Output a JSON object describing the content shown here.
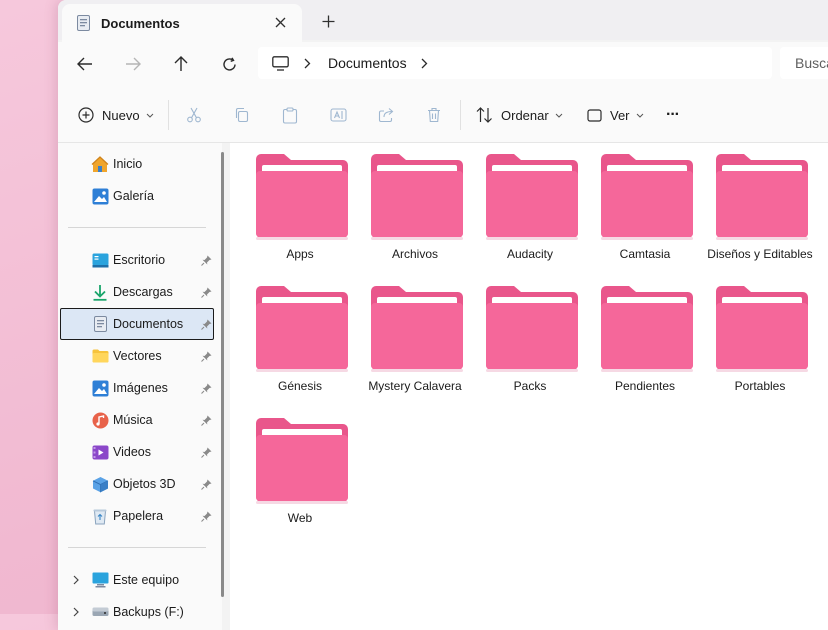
{
  "window": {
    "tab_title": "Documentos",
    "new_tab_symbol": "+"
  },
  "address": {
    "crumb": "Documentos",
    "search_placeholder": "Buscar en Documentos"
  },
  "commands": {
    "new_label": "Nuevo",
    "sort_label": "Ordenar",
    "view_label": "Ver",
    "more_label": "···"
  },
  "sidebar": {
    "top": [
      {
        "label": "Inicio",
        "icon": "home-icon"
      },
      {
        "label": "Galería",
        "icon": "gallery-icon"
      }
    ],
    "pinned": [
      {
        "label": "Escritorio",
        "icon": "desktop-icon"
      },
      {
        "label": "Descargas",
        "icon": "download-icon"
      },
      {
        "label": "Documentos",
        "icon": "document-icon",
        "selected": true
      },
      {
        "label": "Vectores",
        "icon": "folder-icon"
      },
      {
        "label": "Imágenes",
        "icon": "image-icon"
      },
      {
        "label": "Música",
        "icon": "music-icon"
      },
      {
        "label": "Videos",
        "icon": "video-icon"
      },
      {
        "label": "Objetos 3D",
        "icon": "cube-icon"
      },
      {
        "label": "Papelera",
        "icon": "recycle-bin-icon"
      }
    ],
    "drives": [
      {
        "label": "Este equipo",
        "icon": "computer-icon"
      },
      {
        "label": "Backups (F:)",
        "icon": "drive-icon"
      }
    ]
  },
  "folders": [
    {
      "name": "Apps"
    },
    {
      "name": "Archivos"
    },
    {
      "name": "Audacity"
    },
    {
      "name": "Camtasia"
    },
    {
      "name": "Diseños y Editables"
    },
    {
      "name": "Génesis"
    },
    {
      "name": "Mystery Calavera"
    },
    {
      "name": "Packs"
    },
    {
      "name": "Pendientes"
    },
    {
      "name": "Portables"
    },
    {
      "name": "Web"
    }
  ],
  "colors": {
    "folder": "#f5679a",
    "folder_dark": "#e9568b",
    "accent": "#005fb8",
    "selected_bg": "#dce7f5"
  }
}
